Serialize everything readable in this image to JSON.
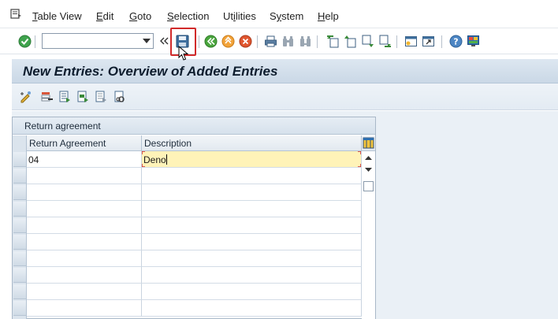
{
  "menu": {
    "items": [
      {
        "label": "Table View",
        "key": "T"
      },
      {
        "label": "Edit",
        "key": "E"
      },
      {
        "label": "Goto",
        "key": "G"
      },
      {
        "label": "Selection",
        "key": "S"
      },
      {
        "label": "Utilities",
        "key": "i"
      },
      {
        "label": "System",
        "key": "y"
      },
      {
        "label": "Help",
        "key": "H"
      }
    ]
  },
  "toolbar": {
    "command_value": "",
    "icons": [
      "enter-icon",
      "back-arrows-icon",
      "save-icon",
      "back-icon",
      "exit-icon",
      "cancel-icon",
      "print-icon",
      "find-icon",
      "find-next-icon",
      "first-page-icon",
      "previous-page-icon",
      "next-page-icon",
      "last-page-icon",
      "create-session-icon",
      "shortcut-icon",
      "help-icon",
      "customize-layout-icon"
    ]
  },
  "title": {
    "text": "New Entries: Overview of Added Entries"
  },
  "app_toolbar": {
    "icons": [
      "display-change-icon",
      "delete-icon",
      "select-all-icon",
      "select-block-icon",
      "deselect-all-icon",
      "configure-icon"
    ]
  },
  "grid": {
    "title": "Return agreement",
    "columns": [
      "Return Agreement",
      "Description"
    ],
    "rows": [
      {
        "agreement": "04",
        "description": "Deno"
      }
    ]
  },
  "colors": {
    "accent_red": "#d12a2a",
    "title_bg": "#cad8e6",
    "active_cell": "#fff3b8"
  }
}
